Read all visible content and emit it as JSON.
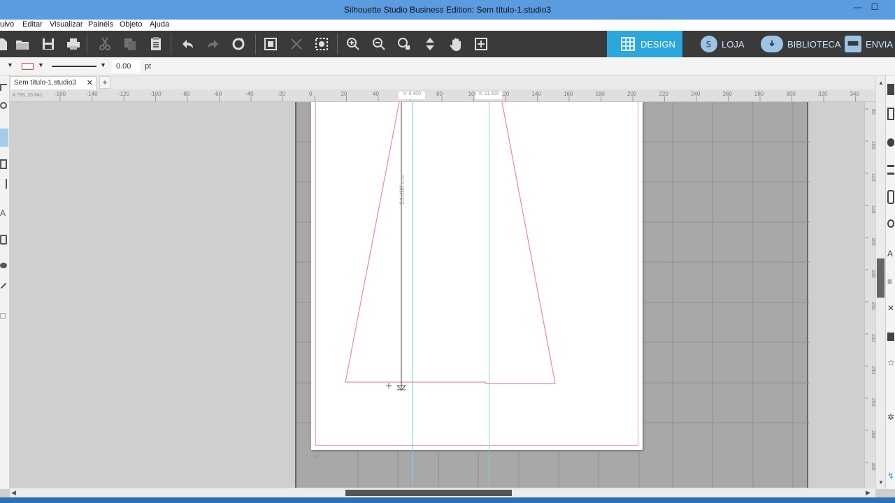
{
  "window": {
    "title": "Silhouette Studio Business Edition: Sem título-1.studio3",
    "minimize": "—",
    "maximize": "☐"
  },
  "menu": [
    "uivo",
    "Editar",
    "Visualizar",
    "Painéis",
    "Objeto",
    "Ajuda"
  ],
  "toolbar": {
    "nav_tabs": [
      {
        "label": "DESIGN",
        "icon": "grid-icon"
      },
      {
        "label": "LOJA",
        "icon": "store-s-icon"
      },
      {
        "label": "BIBLIOTECA",
        "icon": "cloud-download-icon"
      },
      {
        "label": "ENVIA",
        "icon": "send-cutter-icon"
      }
    ]
  },
  "properties": {
    "line_width_value": "0.00",
    "line_width_unit": "pt",
    "fill_color": "#e0453f"
  },
  "document_tabs": [
    {
      "label": "Sem título-1.studio3",
      "close": "✕"
    }
  ],
  "add_tab": "+",
  "hruler": {
    "ticks": [
      "-160",
      "-140",
      "-120",
      "-100",
      "-80",
      "-60",
      "-40",
      "-20",
      "0",
      "20",
      "40",
      "60",
      "80",
      "100",
      "120",
      "140",
      "160",
      "180",
      "200",
      "220",
      "240",
      "260",
      "280",
      "300",
      "320",
      "340"
    ],
    "coord_readout": "4.783, 25.841",
    "guide_marker_1": "X: 6.400",
    "guide_marker_2": "X: 11.300"
  },
  "vruler": {
    "ticks": [
      "80",
      "100",
      "120",
      "140",
      "160",
      "180",
      "200",
      "220",
      "240",
      "260",
      "280",
      "300"
    ]
  },
  "canvas": {
    "dimension_label": "24.460 cm",
    "shape_color": "#ef8c8c",
    "guide_color": "#7fd0e6",
    "page_label": "",
    "bottom_mark": "12"
  },
  "colors": {
    "titlebar": "#5b9be0",
    "toolbar": "#3a3a3a",
    "design_tab": "#2aa7dc",
    "accent_red": "#e0453f"
  }
}
